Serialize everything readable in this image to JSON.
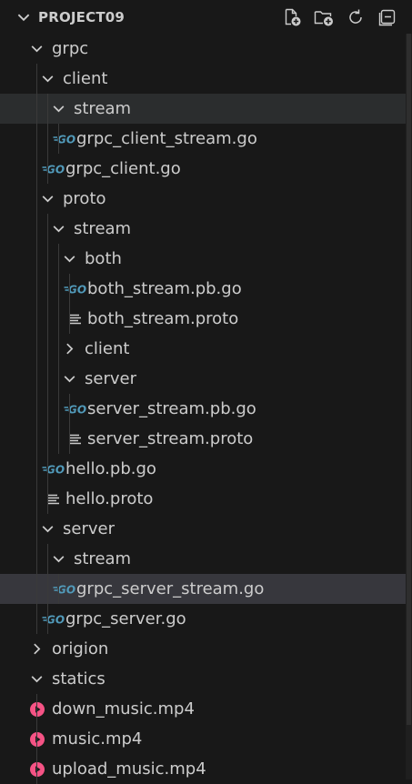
{
  "explorer": {
    "section_title": "PROJECT09",
    "actions": [
      {
        "name": "new-file-button",
        "icon": "new-file-icon"
      },
      {
        "name": "new-folder-button",
        "icon": "new-folder-icon"
      },
      {
        "name": "refresh-button",
        "icon": "refresh-icon"
      },
      {
        "name": "collapse-all-button",
        "icon": "collapse-all-icon"
      }
    ]
  },
  "tree": [
    {
      "label": "grpc",
      "kind": "folder",
      "expanded": true,
      "depth": 0
    },
    {
      "label": "client",
      "kind": "folder",
      "expanded": true,
      "depth": 1
    },
    {
      "label": "stream",
      "kind": "folder",
      "expanded": true,
      "depth": 2,
      "state": "hover"
    },
    {
      "label": "grpc_client_stream.go",
      "kind": "go",
      "depth": 3
    },
    {
      "label": "grpc_client.go",
      "kind": "go",
      "depth": 2
    },
    {
      "label": "proto",
      "kind": "folder",
      "expanded": true,
      "depth": 1
    },
    {
      "label": "stream",
      "kind": "folder",
      "expanded": true,
      "depth": 2
    },
    {
      "label": "both",
      "kind": "folder",
      "expanded": true,
      "depth": 3
    },
    {
      "label": "both_stream.pb.go",
      "kind": "go",
      "depth": 4
    },
    {
      "label": "both_stream.proto",
      "kind": "proto",
      "depth": 4
    },
    {
      "label": "client",
      "kind": "folder",
      "expanded": false,
      "depth": 3
    },
    {
      "label": "server",
      "kind": "folder",
      "expanded": true,
      "depth": 3
    },
    {
      "label": "server_stream.pb.go",
      "kind": "go",
      "depth": 4
    },
    {
      "label": "server_stream.proto",
      "kind": "proto",
      "depth": 4
    },
    {
      "label": "hello.pb.go",
      "kind": "go",
      "depth": 2
    },
    {
      "label": "hello.proto",
      "kind": "proto",
      "depth": 2
    },
    {
      "label": "server",
      "kind": "folder",
      "expanded": true,
      "depth": 1
    },
    {
      "label": "stream",
      "kind": "folder",
      "expanded": true,
      "depth": 2
    },
    {
      "label": "grpc_server_stream.go",
      "kind": "go",
      "depth": 3,
      "state": "selected"
    },
    {
      "label": "grpc_server.go",
      "kind": "go",
      "depth": 2
    },
    {
      "label": "origion",
      "kind": "folder",
      "expanded": false,
      "depth": 0
    },
    {
      "label": "statics",
      "kind": "folder",
      "expanded": true,
      "depth": 0
    },
    {
      "label": "down_music.mp4",
      "kind": "media",
      "depth": 1
    },
    {
      "label": "music.mp4",
      "kind": "media",
      "depth": 1
    },
    {
      "label": "upload_music.mp4",
      "kind": "media",
      "depth": 1
    }
  ],
  "colors": {
    "background": "#181818",
    "text": "#cccccc",
    "go_icon": "#519aba",
    "media_icon": "#f55385",
    "hover_row": "#2b2d2e",
    "selected_row": "#37373d",
    "indent_guide": "#3a3a3a"
  },
  "icons": {
    "folder_open": "chevron-down-icon",
    "folder_closed": "chevron-right-icon",
    "go": "go-file-icon",
    "proto": "proto-file-icon",
    "media": "media-file-icon"
  }
}
